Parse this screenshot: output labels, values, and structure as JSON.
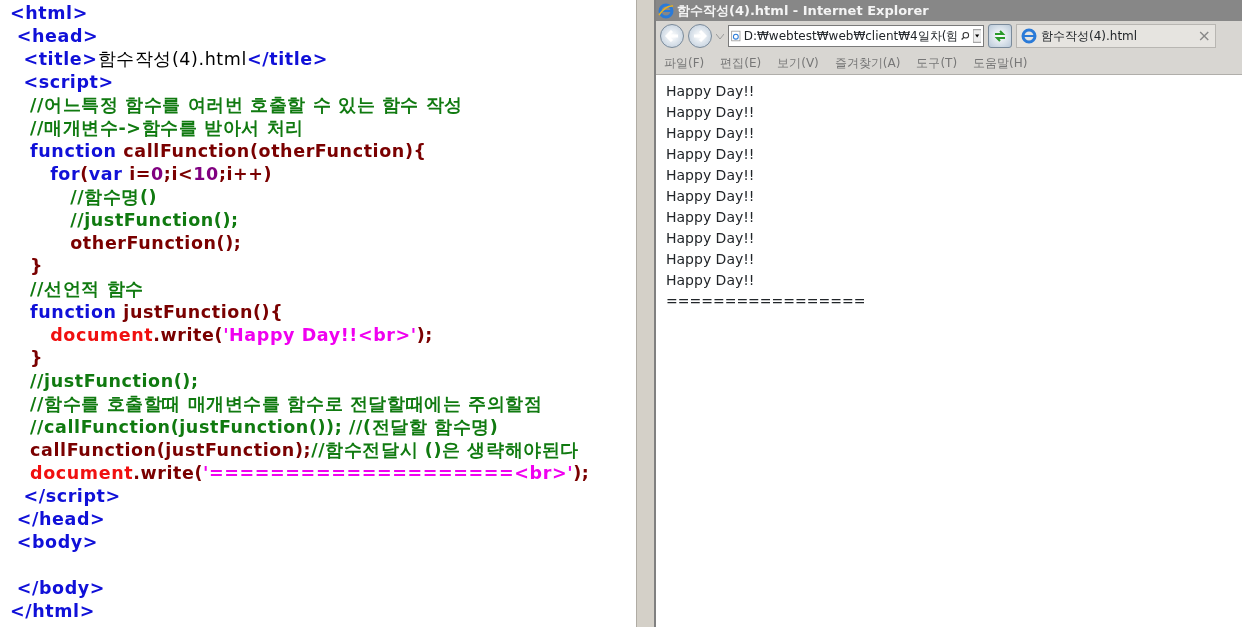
{
  "editor": {
    "lines": [
      {
        "tokens": [
          {
            "kind": "tag",
            "text": "<html>"
          }
        ]
      },
      {
        "tokens": [
          {
            "kind": "tag",
            "text": " <head>"
          }
        ]
      },
      {
        "tokens": [
          {
            "kind": "tag",
            "text": "  <title>"
          },
          {
            "kind": "text",
            "text": "함수작성(4).html"
          },
          {
            "kind": "tag",
            "text": "</title>"
          }
        ]
      },
      {
        "tokens": [
          {
            "kind": "tag",
            "text": "  <script>"
          }
        ]
      },
      {
        "tokens": [
          {
            "kind": "comment",
            "text": "   //어느특정 함수를 여러번 호출할 수 있는 함수 작성"
          }
        ]
      },
      {
        "tokens": [
          {
            "kind": "comment",
            "text": "   //매개변수->함수를 받아서 처리"
          }
        ]
      },
      {
        "tokens": [
          {
            "kind": "keyword",
            "text": "   function "
          },
          {
            "kind": "ident",
            "text": "callFunction(otherFunction){"
          }
        ]
      },
      {
        "tokens": [
          {
            "kind": "keyword",
            "text": "      for"
          },
          {
            "kind": "ident",
            "text": "("
          },
          {
            "kind": "keyword",
            "text": "var "
          },
          {
            "kind": "ident",
            "text": "i="
          },
          {
            "kind": "number",
            "text": "0"
          },
          {
            "kind": "ident",
            "text": ";i<"
          },
          {
            "kind": "number",
            "text": "10"
          },
          {
            "kind": "ident",
            "text": ";i++)"
          }
        ]
      },
      {
        "tokens": [
          {
            "kind": "comment",
            "text": "         //함수명()"
          }
        ]
      },
      {
        "tokens": [
          {
            "kind": "comment",
            "text": "         //justFunction();"
          }
        ]
      },
      {
        "tokens": [
          {
            "kind": "ident",
            "text": "         otherFunction();"
          }
        ]
      },
      {
        "tokens": [
          {
            "kind": "ident",
            "text": "   }"
          }
        ]
      },
      {
        "tokens": [
          {
            "kind": "comment",
            "text": "   //선언적 함수"
          }
        ]
      },
      {
        "tokens": [
          {
            "kind": "keyword",
            "text": "   function "
          },
          {
            "kind": "ident",
            "text": "justFunction(){"
          }
        ]
      },
      {
        "tokens": [
          {
            "kind": "object",
            "text": "      document"
          },
          {
            "kind": "ident",
            "text": ".write("
          },
          {
            "kind": "string",
            "text": "'Happy Day!!<br>'"
          },
          {
            "kind": "ident",
            "text": ");"
          }
        ]
      },
      {
        "tokens": [
          {
            "kind": "ident",
            "text": "   }"
          }
        ]
      },
      {
        "tokens": [
          {
            "kind": "comment",
            "text": "   //justFunction();"
          }
        ]
      },
      {
        "tokens": [
          {
            "kind": "comment",
            "text": "   //함수를 호출할때 매개변수를 함수로 전달할때에는 주의할점"
          }
        ]
      },
      {
        "tokens": [
          {
            "kind": "comment",
            "text": "   //callFunction(justFunction()); //(전달할 함수명)"
          }
        ]
      },
      {
        "tokens": [
          {
            "kind": "ident",
            "text": "   callFunction(justFunction);"
          },
          {
            "kind": "comment",
            "text": "//함수전달시 ()은 생략해야된다"
          }
        ]
      },
      {
        "tokens": [
          {
            "kind": "object",
            "text": "   document"
          },
          {
            "kind": "ident",
            "text": ".write("
          },
          {
            "kind": "string",
            "text": "'====================<br>'"
          },
          {
            "kind": "ident",
            "text": ");"
          }
        ]
      },
      {
        "tokens": [
          {
            "kind": "tag",
            "text": "  </script>"
          }
        ]
      },
      {
        "tokens": [
          {
            "kind": "tag",
            "text": " </head>"
          }
        ]
      },
      {
        "tokens": [
          {
            "kind": "tag",
            "text": " <body>"
          }
        ]
      },
      {
        "blank": true
      },
      {
        "tokens": [
          {
            "kind": "tag",
            "text": " </body>"
          }
        ]
      },
      {
        "tokens": [
          {
            "kind": "tag",
            "text": "</html>"
          }
        ]
      }
    ]
  },
  "browser": {
    "window": {
      "title": "함수작성(4).html - Internet Explorer"
    },
    "address": "D:₩webtest₩web₩client₩4일차(힘",
    "tab": {
      "label": "함수작성(4).html",
      "close": "×"
    },
    "menu": [
      "파일(F)",
      "편집(E)",
      "보기(V)",
      "즐겨찾기(A)",
      "도구(T)",
      "도움말(H)"
    ],
    "content": [
      "Happy Day!!",
      "Happy Day!!",
      "Happy Day!!",
      "Happy Day!!",
      "Happy Day!!",
      "Happy Day!!",
      "Happy Day!!",
      "Happy Day!!",
      "Happy Day!!",
      "Happy Day!!",
      "================="
    ]
  }
}
